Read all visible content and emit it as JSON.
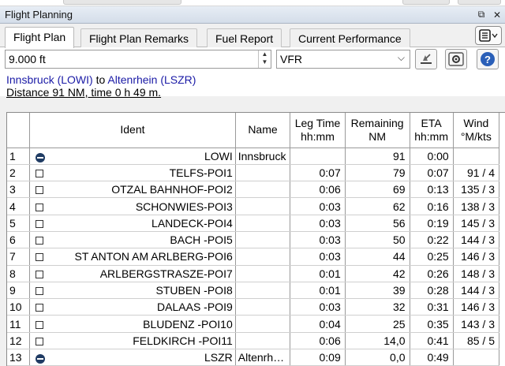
{
  "window": {
    "title": "Flight Planning"
  },
  "tabs": [
    {
      "label": "Flight Plan",
      "active": true
    },
    {
      "label": "Flight Plan Remarks",
      "active": false
    },
    {
      "label": "Fuel Report",
      "active": false
    },
    {
      "label": "Current Performance",
      "active": false
    }
  ],
  "toolbar": {
    "altitude_value": "9.000 ft",
    "flight_rules_value": "VFR",
    "icons": [
      "window-pin-icon",
      "window-close-icon",
      "menu-icon",
      "runway-icon",
      "settings-icon",
      "help-icon"
    ]
  },
  "route": {
    "from_label": "Innsbruck (LOWI)",
    "to_word": "to",
    "to_label": "Altenrhein (LSZR)",
    "summary": "Distance 91 NM, time 0 h 49 m."
  },
  "table": {
    "headers": {
      "ident": "Ident",
      "name": "Name",
      "leg_time": [
        "Leg Time",
        "hh:mm"
      ],
      "remaining": [
        "Remaining",
        "NM"
      ],
      "eta": [
        "ETA",
        "hh:mm"
      ],
      "wind": [
        "Wind",
        "°M/kts"
      ]
    },
    "rows": [
      {
        "n": "1",
        "marker": "circle",
        "ident": "LOWI",
        "name": "Innsbruck",
        "leg": "",
        "rem": "91",
        "eta": "0:00",
        "wind": ""
      },
      {
        "n": "2",
        "marker": "box",
        "ident": "TELFS-POI1",
        "name": "",
        "leg": "0:07",
        "rem": "79",
        "eta": "0:07",
        "wind": "91 / 4"
      },
      {
        "n": "3",
        "marker": "box",
        "ident": "OTZAL BAHNHOF-POI2",
        "name": "",
        "leg": "0:06",
        "rem": "69",
        "eta": "0:13",
        "wind": "135 / 3"
      },
      {
        "n": "4",
        "marker": "box",
        "ident": "SCHONWIES-POI3",
        "name": "",
        "leg": "0:03",
        "rem": "62",
        "eta": "0:16",
        "wind": "138 / 3"
      },
      {
        "n": "5",
        "marker": "box",
        "ident": "LANDECK-POI4",
        "name": "",
        "leg": "0:03",
        "rem": "56",
        "eta": "0:19",
        "wind": "145 / 3"
      },
      {
        "n": "6",
        "marker": "box",
        "ident": "BACH -POI5",
        "name": "",
        "leg": "0:03",
        "rem": "50",
        "eta": "0:22",
        "wind": "144 / 3"
      },
      {
        "n": "7",
        "marker": "box",
        "ident": "ST ANTON AM ARLBERG-POI6",
        "name": "",
        "leg": "0:03",
        "rem": "44",
        "eta": "0:25",
        "wind": "146 / 3"
      },
      {
        "n": "8",
        "marker": "box",
        "ident": "ARLBERGSTRASZE-POI7",
        "name": "",
        "leg": "0:01",
        "rem": "42",
        "eta": "0:26",
        "wind": "148 / 3"
      },
      {
        "n": "9",
        "marker": "box",
        "ident": "STUBEN -POI8",
        "name": "",
        "leg": "0:01",
        "rem": "39",
        "eta": "0:28",
        "wind": "144 / 3"
      },
      {
        "n": "10",
        "marker": "box",
        "ident": "DALAAS -POI9",
        "name": "",
        "leg": "0:03",
        "rem": "32",
        "eta": "0:31",
        "wind": "146 / 3"
      },
      {
        "n": "11",
        "marker": "box",
        "ident": "BLUDENZ -POI10",
        "name": "",
        "leg": "0:04",
        "rem": "25",
        "eta": "0:35",
        "wind": "143 / 3"
      },
      {
        "n": "12",
        "marker": "box",
        "ident": "FELDKIRCH -POI11",
        "name": "",
        "leg": "0:06",
        "rem": "14,0",
        "eta": "0:41",
        "wind": "85 / 5"
      },
      {
        "n": "13",
        "marker": "circle",
        "ident": "LSZR",
        "name": "Altenrh…",
        "leg": "0:09",
        "rem": "0,0",
        "eta": "0:49",
        "wind": ""
      }
    ]
  },
  "colors": {
    "link": "#1a1aa6",
    "title_bar": "#d4dde9",
    "marker_circle": "#1f3b63"
  }
}
